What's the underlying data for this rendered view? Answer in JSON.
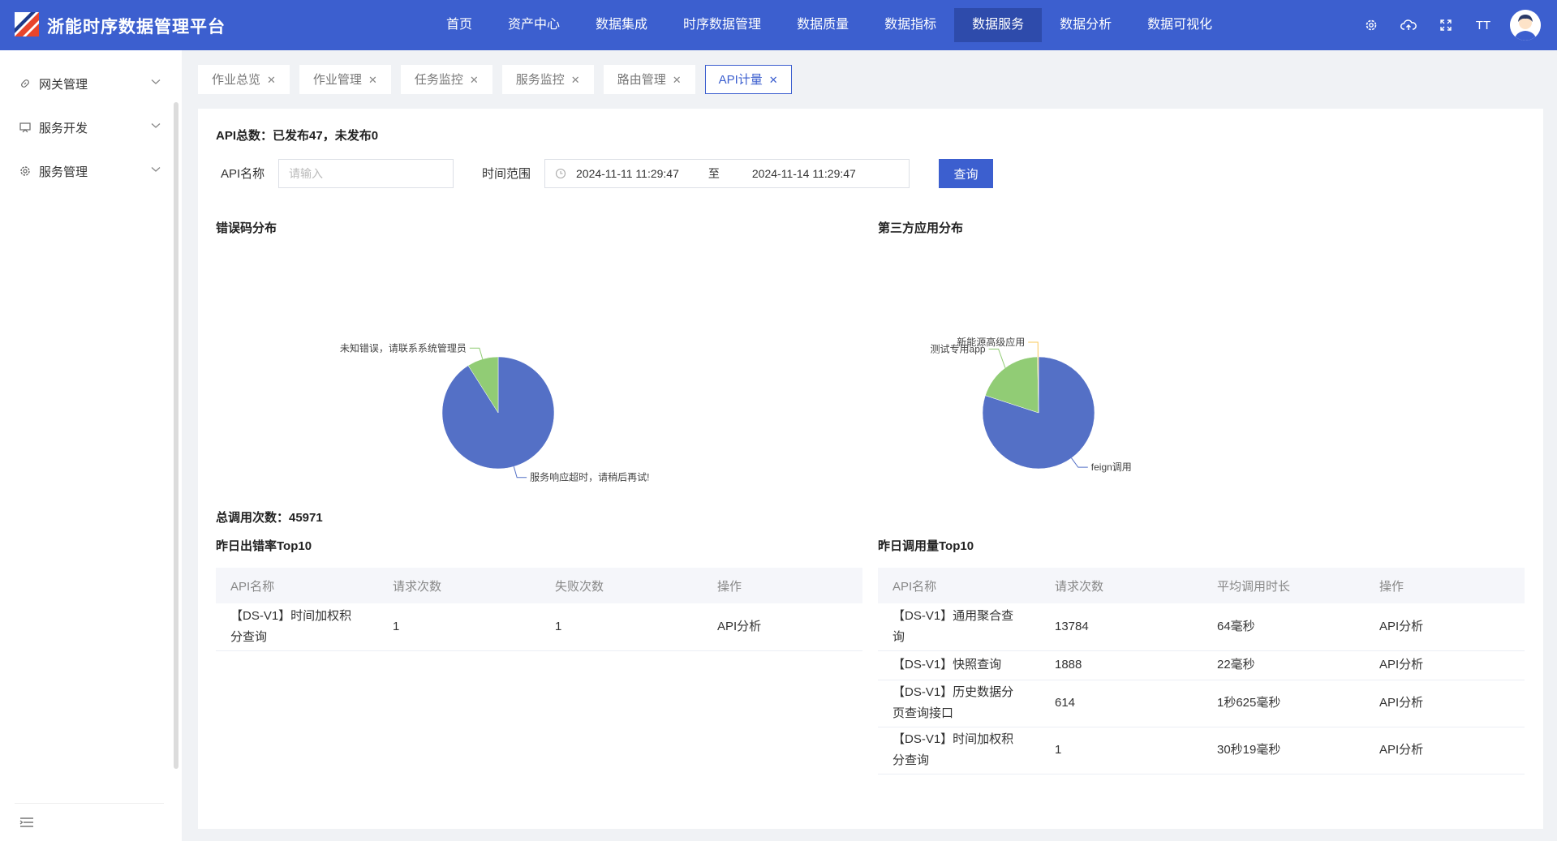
{
  "header": {
    "brand": "浙能时序数据管理平台",
    "nav": [
      {
        "label": "首页",
        "active": false
      },
      {
        "label": "资产中心",
        "active": false
      },
      {
        "label": "数据集成",
        "active": false
      },
      {
        "label": "时序数据管理",
        "active": false
      },
      {
        "label": "数据质量",
        "active": false
      },
      {
        "label": "数据指标",
        "active": false
      },
      {
        "label": "数据服务",
        "active": true
      },
      {
        "label": "数据分析",
        "active": false
      },
      {
        "label": "数据可视化",
        "active": false
      }
    ],
    "icons": [
      "gear-icon",
      "cloud-upload-icon",
      "fullscreen-icon",
      "font-size-icon",
      "user-avatar"
    ],
    "font_size_glyph": "TT"
  },
  "sidebar": {
    "items": [
      {
        "label": "网关管理",
        "icon": "link-icon"
      },
      {
        "label": "服务开发",
        "icon": "dev-board-icon"
      },
      {
        "label": "服务管理",
        "icon": "gear-icon"
      }
    ]
  },
  "tabs": [
    {
      "label": "作业总览",
      "active": false
    },
    {
      "label": "作业管理",
      "active": false
    },
    {
      "label": "任务监控",
      "active": false
    },
    {
      "label": "服务监控",
      "active": false
    },
    {
      "label": "路由管理",
      "active": false
    },
    {
      "label": "API计量",
      "active": true
    }
  ],
  "main": {
    "api_total": "API总数：已发布47，未发布0",
    "search": {
      "api_name_label": "API名称",
      "api_name_placeholder": "请输入",
      "time_range_label": "时间范围",
      "start_time": "2024-11-11 11:29:47",
      "separator": "至",
      "end_time": "2024-11-14 11:29:47",
      "query_button": "查询"
    },
    "error_pie_title": "错误码分布",
    "app_pie_title": "第三方应用分布",
    "total_calls": "总调用次数：45971",
    "error_top_title": "昨日出错率Top10",
    "usage_top_title": "昨日调用量Top10",
    "error_table": {
      "columns": [
        "API名称",
        "请求次数",
        "失败次数",
        "操作"
      ],
      "rows": [
        {
          "name": [
            "【DS-V1】时间加权积",
            "分查询"
          ],
          "requests": "1",
          "failures": "1",
          "action": "API分析"
        }
      ]
    },
    "usage_table": {
      "columns": [
        "API名称",
        "请求次数",
        "平均调用时长",
        "操作"
      ],
      "rows": [
        {
          "name": [
            "【DS-V1】通用聚合查",
            "询"
          ],
          "requests": "13784",
          "avg": "64毫秒",
          "action": "API分析"
        },
        {
          "name": [
            "【DS-V1】快照查询"
          ],
          "requests": "1888",
          "avg": "22毫秒",
          "action": "API分析"
        },
        {
          "name": [
            "【DS-V1】历史数据分",
            "页查询接口"
          ],
          "requests": "614",
          "avg": "1秒625毫秒",
          "action": "API分析"
        },
        {
          "name": [
            "【DS-V1】时间加权积",
            "分查询"
          ],
          "requests": "1",
          "avg": "30秒19毫秒",
          "action": "API分析"
        }
      ]
    }
  },
  "chart_data": [
    {
      "type": "pie",
      "title": "错误码分布",
      "slices": [
        {
          "label": "服务响应超时，请稍后再试!",
          "value": 91,
          "color": "#5470c6"
        },
        {
          "label": "未知错误，请联系系统管理员",
          "value": 9,
          "color": "#91cc75"
        }
      ]
    },
    {
      "type": "pie",
      "title": "第三方应用分布",
      "slices": [
        {
          "label": "feign调用",
          "value": 80,
          "color": "#5470c6"
        },
        {
          "label": "测试专用app",
          "value": 19.7,
          "color": "#91cc75"
        },
        {
          "label": "新能源高级应用",
          "value": 0.3,
          "color": "#fac858"
        }
      ]
    }
  ]
}
